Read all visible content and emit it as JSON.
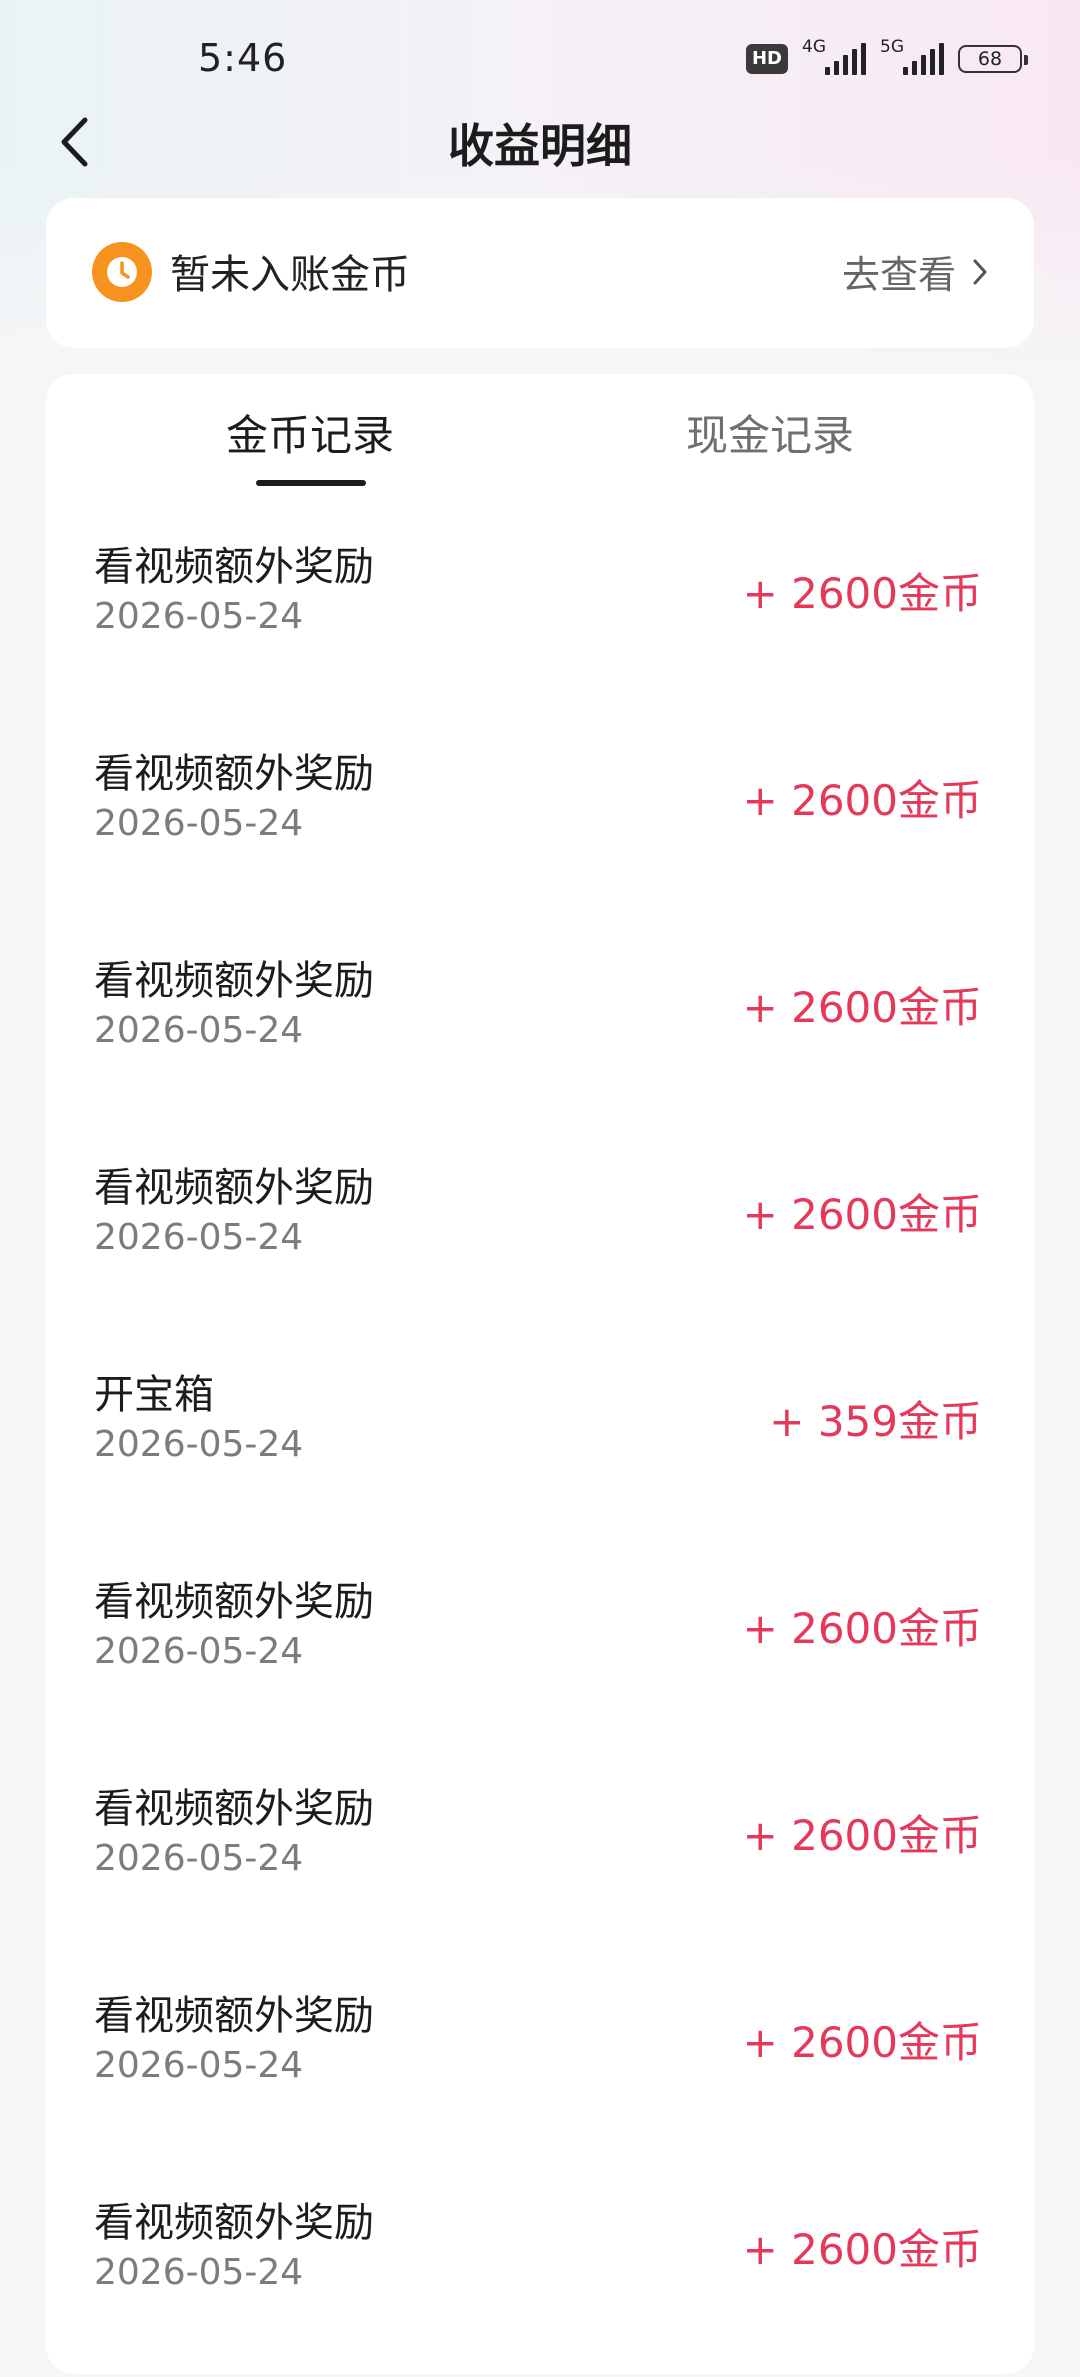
{
  "status_bar": {
    "time": "5:46",
    "hd_label": "HD",
    "network_1": "4G",
    "network_2": "5G",
    "battery": "68"
  },
  "header": {
    "title": "收益明细",
    "back_icon": "chevron-left-icon"
  },
  "pending": {
    "icon": "clock-icon",
    "label": "暂未入账金币",
    "link_text": "去查看",
    "link_icon": "chevron-right-icon",
    "icon_color": "#f7921e"
  },
  "tabs": [
    {
      "label": "金币记录",
      "active": true
    },
    {
      "label": "现金记录",
      "active": false
    }
  ],
  "records": [
    {
      "title": "看视频额外奖励",
      "date": "2026-05-24",
      "amount": "+ 2600金币"
    },
    {
      "title": "看视频额外奖励",
      "date": "2026-05-24",
      "amount": "+ 2600金币"
    },
    {
      "title": "看视频额外奖励",
      "date": "2026-05-24",
      "amount": "+ 2600金币"
    },
    {
      "title": "看视频额外奖励",
      "date": "2026-05-24",
      "amount": "+ 2600金币"
    },
    {
      "title": "开宝箱",
      "date": "2026-05-24",
      "amount": "+ 359金币"
    },
    {
      "title": "看视频额外奖励",
      "date": "2026-05-24",
      "amount": "+ 2600金币"
    },
    {
      "title": "看视频额外奖励",
      "date": "2026-05-24",
      "amount": "+ 2600金币"
    },
    {
      "title": "看视频额外奖励",
      "date": "2026-05-24",
      "amount": "+ 2600金币"
    },
    {
      "title": "看视频额外奖励",
      "date": "2026-05-24",
      "amount": "+ 2600金币"
    }
  ],
  "colors": {
    "amount": "#e5385a",
    "accent_orange": "#f7921e",
    "background": "#f6f6f7"
  }
}
